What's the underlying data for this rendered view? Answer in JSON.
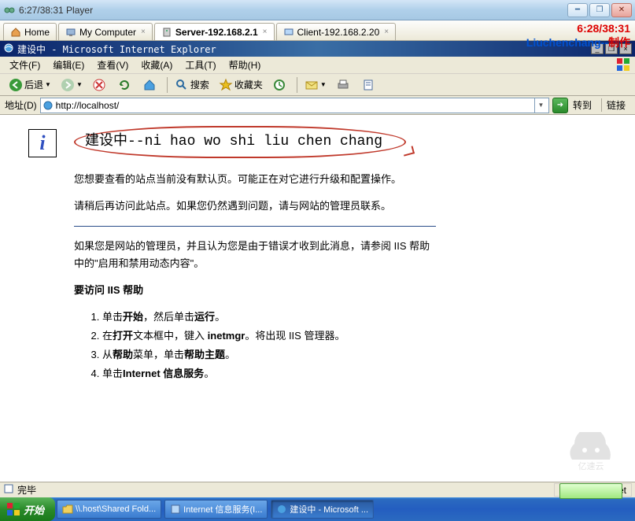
{
  "player_title": "6:27/38:31 Player",
  "overlay": {
    "timer": "6:28/38:31",
    "watermark_a": "Liuchenchang--",
    "watermark_b": "制作"
  },
  "tabs": [
    {
      "label": "Home",
      "icon": "home-icon"
    },
    {
      "label": "My Computer",
      "icon": "computer-icon"
    },
    {
      "label": "Server-192.168.2.1",
      "icon": "server-icon",
      "active": true
    },
    {
      "label": "Client-192.168.2.20",
      "icon": "client-icon"
    }
  ],
  "ie_title": "建设中 - Microsoft Internet Explorer",
  "menu": {
    "file": "文件(F)",
    "edit": "编辑(E)",
    "view": "查看(V)",
    "fav": "收藏(A)",
    "tools": "工具(T)",
    "help": "帮助(H)"
  },
  "toolbar": {
    "back": "后退",
    "search": "搜索",
    "fav": "收藏夹"
  },
  "address": {
    "label": "地址(D)",
    "url": "http://localhost/",
    "go": "转到",
    "links": "链接"
  },
  "content": {
    "heading": "建设中--ni hao wo shi liu chen chang",
    "p1": "您想要查看的站点当前没有默认页。可能正在对它进行升级和配置操作。",
    "p2": "请稍后再访问此站点。如果您仍然遇到问题，请与网站的管理员联系。",
    "p3": "如果您是网站的管理员，并且认为您是由于错误才收到此消息，请参阅 IIS 帮助中的\"启用和禁用动态内容\"。",
    "sub": "要访问 IIS 帮助",
    "li1": "单击<b>开始</b>，然后单击<b>运行</b>。",
    "li2": "在<b>打开</b>文本框中，键入 <b>inetmgr</b>。将出现 IIS 管理器。",
    "li3": "从<b>帮助</b>菜单，单击<b>帮助主题</b>。",
    "li4": "单击<b>Internet 信息服务</b>。"
  },
  "status": {
    "done": "完毕",
    "zone": "本地 Intranet"
  },
  "taskbar": {
    "start": "开始",
    "t1": "\\\\.host\\Shared Fold...",
    "t2": "Internet 信息服务(I...",
    "t3": "建设中 - Microsoft ..."
  }
}
